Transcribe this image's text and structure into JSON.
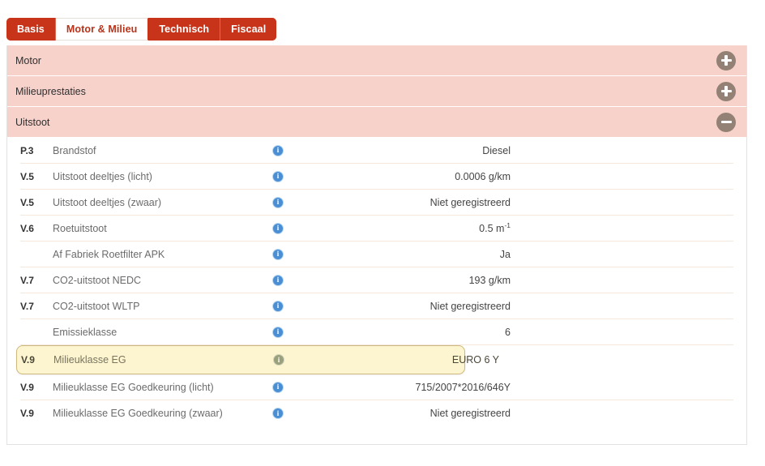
{
  "tabs": [
    {
      "label": "Basis",
      "active": false
    },
    {
      "label": "Motor & Milieu",
      "active": true
    },
    {
      "label": "Technisch",
      "active": false
    },
    {
      "label": "Fiscaal",
      "active": false
    }
  ],
  "sections": [
    {
      "title": "Motor",
      "state": "collapsed",
      "toggle": "plus-icon"
    },
    {
      "title": "Milieuprestaties",
      "state": "collapsed",
      "toggle": "plus-icon"
    },
    {
      "title": "Uitstoot",
      "state": "expanded",
      "toggle": "minus-icon"
    }
  ],
  "info_icon_label": "i",
  "rows": [
    {
      "code": "P.3",
      "label": "Brandstof",
      "value": "Diesel",
      "unit_sup": "",
      "highlighted": false
    },
    {
      "code": "V.5",
      "label": "Uitstoot deeltjes (licht)",
      "value": "0.0006 g/km",
      "unit_sup": "",
      "highlighted": false
    },
    {
      "code": "V.5",
      "label": "Uitstoot deeltjes (zwaar)",
      "value": "Niet geregistreerd",
      "unit_sup": "",
      "highlighted": false
    },
    {
      "code": "V.6",
      "label": "Roetuitstoot",
      "value": "0.5 m",
      "unit_sup": "-1",
      "highlighted": false
    },
    {
      "code": "",
      "label": "Af Fabriek Roetfilter APK",
      "value": "Ja",
      "unit_sup": "",
      "highlighted": false
    },
    {
      "code": "V.7",
      "label": "CO2-uitstoot NEDC",
      "value": "193 g/km",
      "unit_sup": "",
      "highlighted": false
    },
    {
      "code": "V.7",
      "label": "CO2-uitstoot WLTP",
      "value": "Niet geregistreerd",
      "unit_sup": "",
      "highlighted": false
    },
    {
      "code": "",
      "label": "Emissieklasse",
      "value": "6",
      "unit_sup": "",
      "highlighted": false
    },
    {
      "code": "V.9",
      "label": "Milieuklasse EG",
      "value": "EURO 6 Y",
      "unit_sup": "",
      "highlighted": true
    },
    {
      "code": "V.9",
      "label": "Milieuklasse EG Goedkeuring (licht)",
      "value": "715/2007*2016/646Y",
      "unit_sup": "",
      "highlighted": false
    },
    {
      "code": "V.9",
      "label": "Milieuklasse EG Goedkeuring (zwaar)",
      "value": "Niet geregistreerd",
      "unit_sup": "",
      "highlighted": false
    }
  ],
  "colors": {
    "tab_active_bg": "#ffffff",
    "tab_active_text": "#b8331a",
    "tab_bar_bg": "#c8341a",
    "section_header_bg": "#f7d2cb",
    "toggle_circle": "#948175",
    "info_icon": "#4a8fd4",
    "highlight_bg": "#fcf5cf",
    "highlight_border": "#cdb87f",
    "row_divider": "#f4e7dc"
  }
}
